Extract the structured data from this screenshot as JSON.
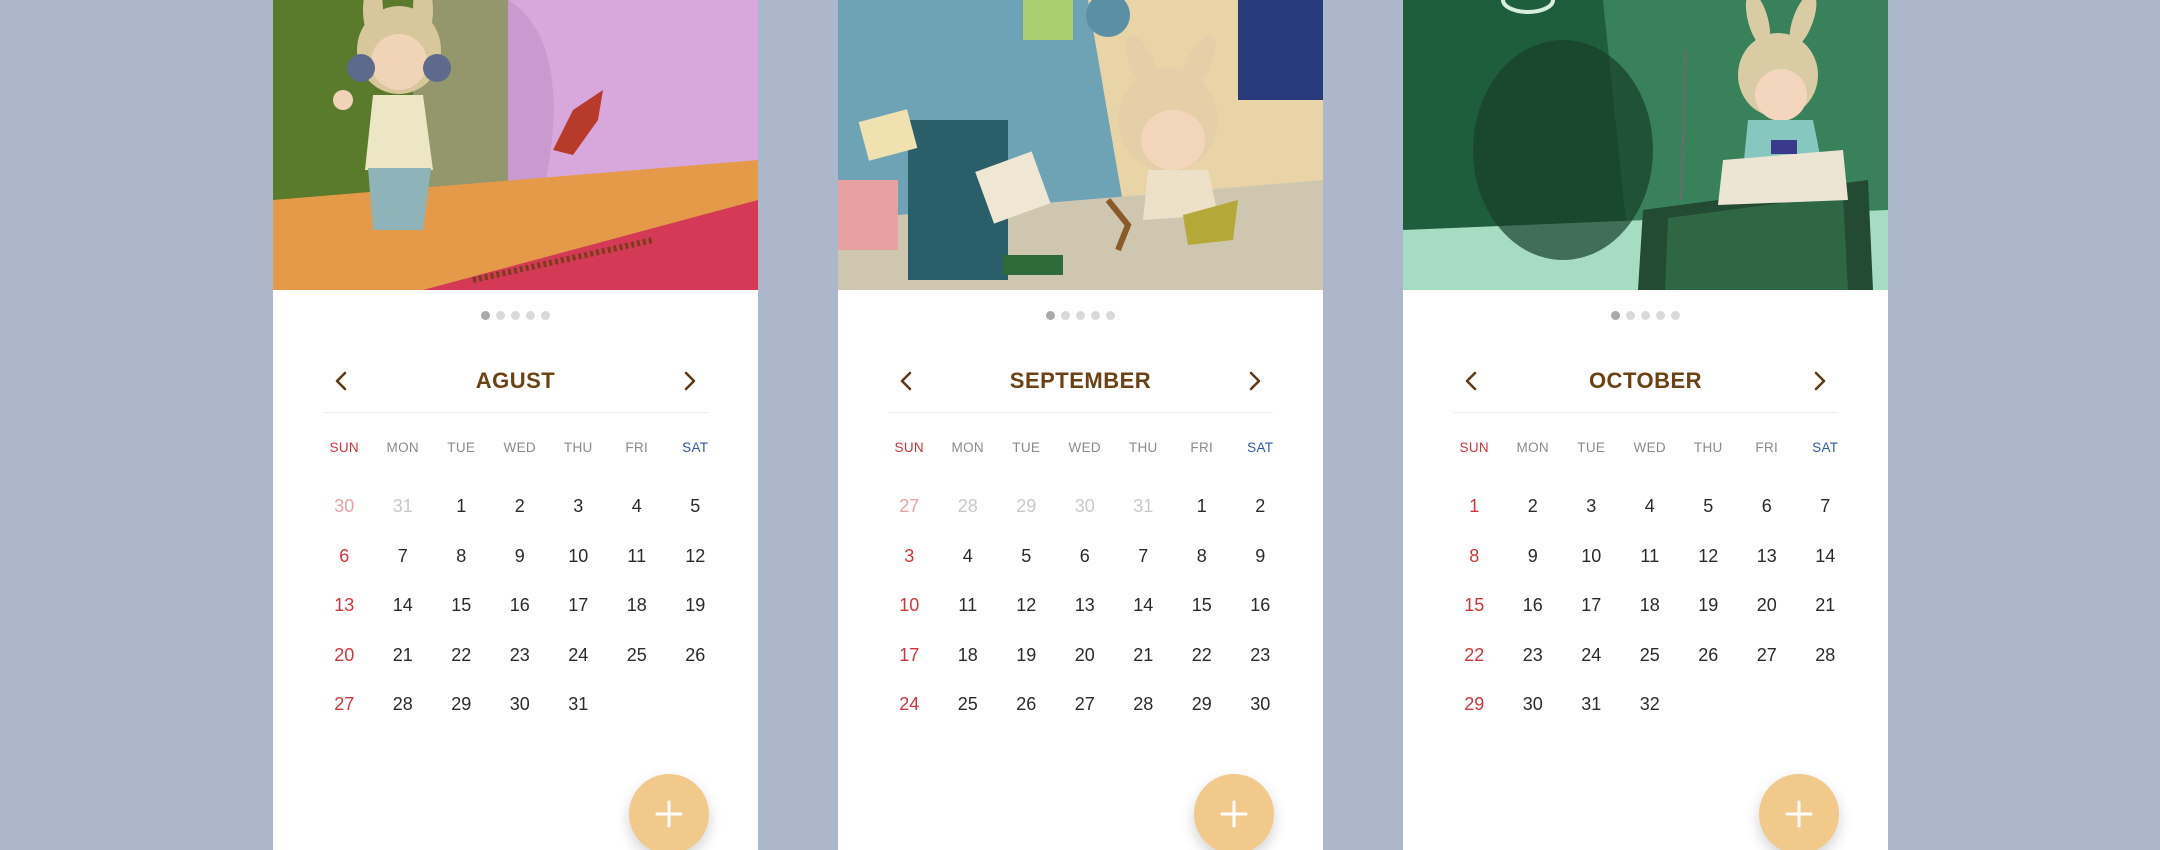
{
  "colors": {
    "background": "#adb7cb",
    "card": "#ffffff",
    "month_title": "#6b4213",
    "sunday": "#d0343a",
    "saturday": "#2f5aa6",
    "fab": "#f0c98b"
  },
  "calendars": [
    {
      "month": "AGUST",
      "illustration": "boy-in-bunny-hat-with-headphones",
      "pager": {
        "count": 5,
        "active": 0
      },
      "weekdays": [
        "SUN",
        "MON",
        "TUE",
        "WED",
        "THU",
        "FRI",
        "SAT"
      ],
      "days": [
        {
          "d": "30",
          "muted": true
        },
        {
          "d": "31",
          "muted": true
        },
        {
          "d": "1"
        },
        {
          "d": "2"
        },
        {
          "d": "3"
        },
        {
          "d": "4"
        },
        {
          "d": "5"
        },
        {
          "d": "6"
        },
        {
          "d": "7"
        },
        {
          "d": "8"
        },
        {
          "d": "9"
        },
        {
          "d": "10"
        },
        {
          "d": "11"
        },
        {
          "d": "12"
        },
        {
          "d": "13"
        },
        {
          "d": "14"
        },
        {
          "d": "15"
        },
        {
          "d": "16"
        },
        {
          "d": "17"
        },
        {
          "d": "18"
        },
        {
          "d": "19"
        },
        {
          "d": "20"
        },
        {
          "d": "21"
        },
        {
          "d": "22"
        },
        {
          "d": "23"
        },
        {
          "d": "24"
        },
        {
          "d": "25"
        },
        {
          "d": "26"
        },
        {
          "d": "27"
        },
        {
          "d": "28"
        },
        {
          "d": "29"
        },
        {
          "d": "30"
        },
        {
          "d": "31"
        }
      ],
      "fab_icon": "plus-icon"
    },
    {
      "month": "SEPTEMBER",
      "illustration": "boy-in-bunny-hat-jumping-pillow-fight",
      "pager": {
        "count": 5,
        "active": 0
      },
      "weekdays": [
        "SUN",
        "MON",
        "TUE",
        "WED",
        "THU",
        "FRI",
        "SAT"
      ],
      "days": [
        {
          "d": "27",
          "muted": true
        },
        {
          "d": "28",
          "muted": true
        },
        {
          "d": "29",
          "muted": true
        },
        {
          "d": "30",
          "muted": true
        },
        {
          "d": "31",
          "muted": true
        },
        {
          "d": "1"
        },
        {
          "d": "2"
        },
        {
          "d": "3"
        },
        {
          "d": "4"
        },
        {
          "d": "5"
        },
        {
          "d": "6"
        },
        {
          "d": "7"
        },
        {
          "d": "8"
        },
        {
          "d": "9"
        },
        {
          "d": "10"
        },
        {
          "d": "11"
        },
        {
          "d": "12"
        },
        {
          "d": "13"
        },
        {
          "d": "14"
        },
        {
          "d": "15"
        },
        {
          "d": "16"
        },
        {
          "d": "17"
        },
        {
          "d": "18"
        },
        {
          "d": "19"
        },
        {
          "d": "20"
        },
        {
          "d": "21"
        },
        {
          "d": "22"
        },
        {
          "d": "23"
        },
        {
          "d": "24"
        },
        {
          "d": "25"
        },
        {
          "d": "26"
        },
        {
          "d": "27"
        },
        {
          "d": "28"
        },
        {
          "d": "29"
        },
        {
          "d": "30"
        }
      ],
      "fab_icon": "plus-icon"
    },
    {
      "month": "OCTOBER",
      "illustration": "boy-in-bunny-hat-playing-games-on-tv",
      "pager": {
        "count": 5,
        "active": 0
      },
      "weekdays": [
        "SUN",
        "MON",
        "TUE",
        "WED",
        "THU",
        "FRI",
        "SAT"
      ],
      "days": [
        {
          "d": "1"
        },
        {
          "d": "2"
        },
        {
          "d": "3"
        },
        {
          "d": "4"
        },
        {
          "d": "5"
        },
        {
          "d": "6"
        },
        {
          "d": "7"
        },
        {
          "d": "8"
        },
        {
          "d": "9"
        },
        {
          "d": "10"
        },
        {
          "d": "11"
        },
        {
          "d": "12"
        },
        {
          "d": "13"
        },
        {
          "d": "14"
        },
        {
          "d": "15"
        },
        {
          "d": "16"
        },
        {
          "d": "17"
        },
        {
          "d": "18"
        },
        {
          "d": "19"
        },
        {
          "d": "20"
        },
        {
          "d": "21"
        },
        {
          "d": "22"
        },
        {
          "d": "23"
        },
        {
          "d": "24"
        },
        {
          "d": "25"
        },
        {
          "d": "26"
        },
        {
          "d": "27"
        },
        {
          "d": "28"
        },
        {
          "d": "29"
        },
        {
          "d": "30"
        },
        {
          "d": "31"
        },
        {
          "d": "32"
        }
      ],
      "fab_icon": "plus-icon"
    }
  ]
}
